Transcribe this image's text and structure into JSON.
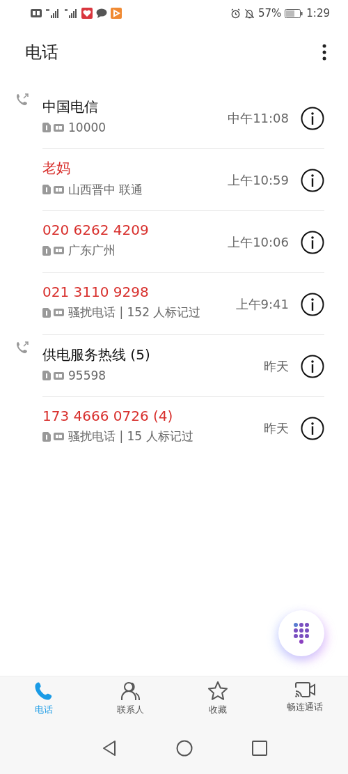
{
  "status_bar": {
    "battery": "57%",
    "time": "1:29"
  },
  "title": "电话",
  "calls": [
    {
      "name": "中国电信",
      "missed": false,
      "outgoing": true,
      "detail": "10000",
      "time": "中午11:08"
    },
    {
      "name": "老妈",
      "missed": true,
      "outgoing": false,
      "detail": "山西晋中 联通",
      "time": "上午10:59"
    },
    {
      "name": "020 6262 4209",
      "missed": true,
      "outgoing": false,
      "detail": "广东广州",
      "time": "上午10:06"
    },
    {
      "name": "021 3110 9298",
      "missed": true,
      "outgoing": false,
      "detail": "骚扰电话 | 152 人标记过",
      "time": "上午9:41"
    },
    {
      "name": "供电服务热线 (5)",
      "missed": false,
      "outgoing": true,
      "detail": "95598",
      "time": "昨天"
    },
    {
      "name": "173 4666 0726 (4)",
      "missed": true,
      "outgoing": false,
      "detail": "骚扰电话 | 15 人标记过",
      "time": "昨天"
    }
  ],
  "tabs": [
    {
      "kind": "phone",
      "label": "电话",
      "selected": true
    },
    {
      "kind": "contacts",
      "label": "联系人",
      "selected": false
    },
    {
      "kind": "star",
      "label": "收藏",
      "selected": false
    },
    {
      "kind": "video",
      "label": "畅连通话",
      "selected": false
    }
  ]
}
